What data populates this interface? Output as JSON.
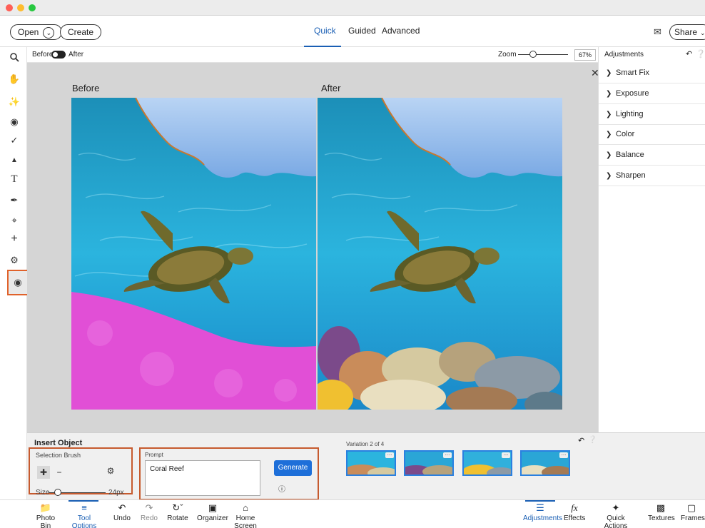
{
  "topbar": {
    "open_label": "Open",
    "create_label": "Create",
    "modes": [
      "Quick",
      "Guided",
      "Advanced"
    ],
    "share_label": "Share"
  },
  "viewbar": {
    "before_label": "Before",
    "after_label": "After",
    "zoom_label": "Zoom",
    "zoom_value": "67%"
  },
  "canvas": {
    "before_title": "Before",
    "after_title": "After"
  },
  "adjustments": {
    "title": "Adjustments",
    "items": [
      "Smart Fix",
      "Exposure",
      "Lighting",
      "Color",
      "Balance",
      "Sharpen"
    ]
  },
  "tools": [
    "zoom-icon",
    "hand-icon",
    "quick-select-icon",
    "red-eye-icon",
    "whiten-teeth-icon",
    "straighten-icon",
    "text-icon",
    "spot-healing-icon",
    "crop-icon",
    "move-icon",
    "move-and-scale-icon",
    "generative-fill-icon"
  ],
  "options": {
    "title": "Insert Object",
    "selection_brush_label": "Selection Brush",
    "size_label": "Size",
    "size_value": "24px",
    "prompt_label": "Prompt",
    "prompt_value": "Coral Reef",
    "generate_label": "Generate",
    "variation_label": "Variation 2 of 4",
    "variations": 4
  },
  "bottombar": {
    "left": [
      "Photo Bin",
      "Tool Options",
      "Undo",
      "Redo",
      "Rotate",
      "Organizer",
      "Home Screen"
    ],
    "right": [
      "Adjustments",
      "Effects",
      "Quick Actions",
      "Textures",
      "Frames"
    ]
  },
  "colors": {
    "accent": "#1a5fb4",
    "highlight_border": "#c65a2e",
    "generate_button": "#1e6fd9",
    "mask_overlay": "#e14fd6"
  }
}
